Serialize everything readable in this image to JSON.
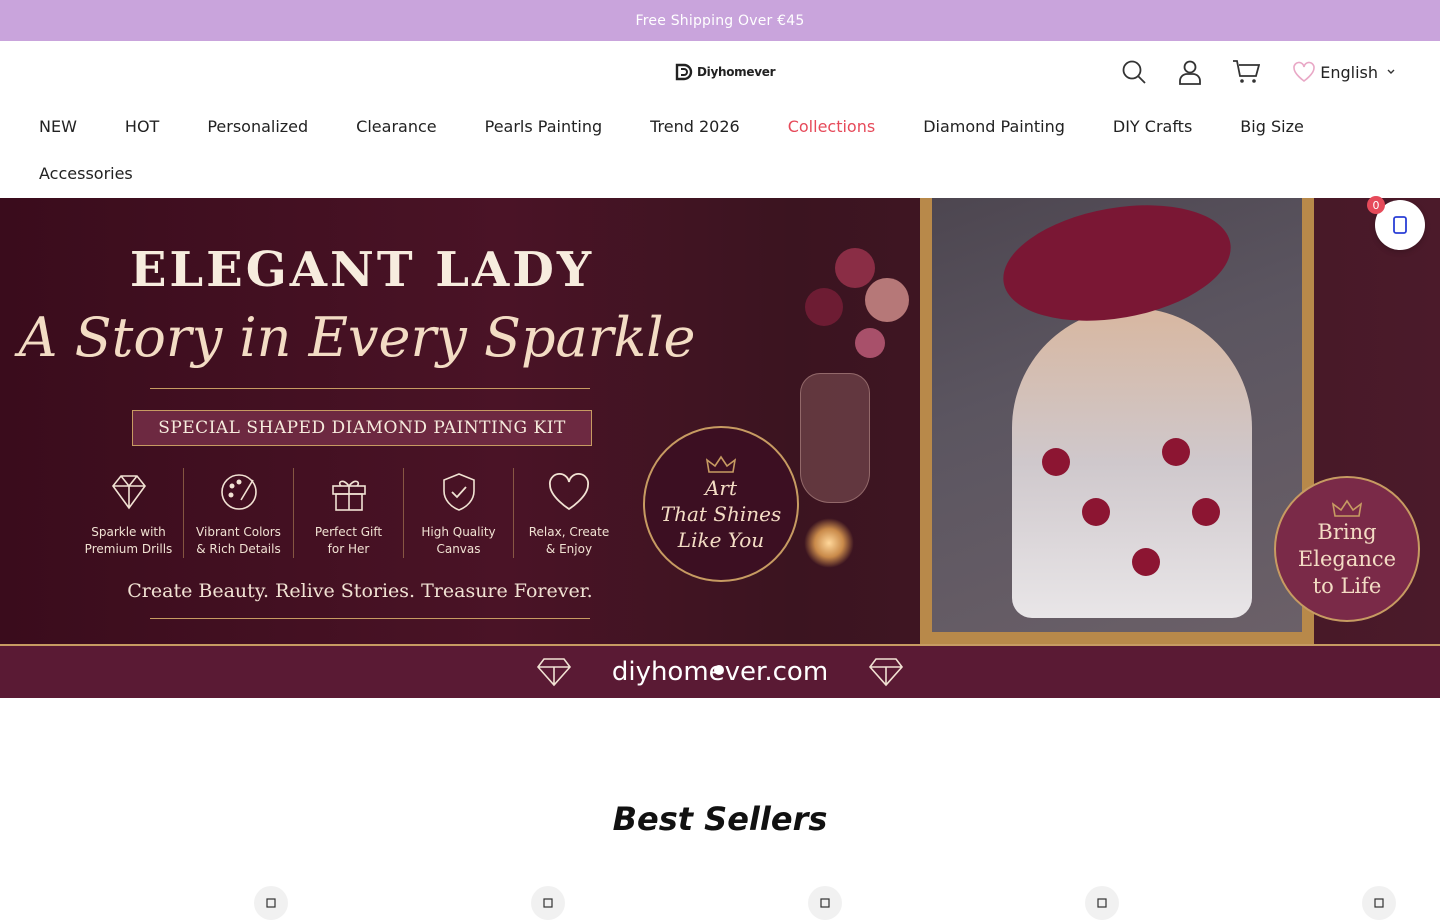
{
  "announcement": {
    "text": "Free Shipping Over €45"
  },
  "header": {
    "logo_text": "Diyhomever",
    "language": "English"
  },
  "nav": {
    "row1": [
      "NEW",
      "HOT",
      "Personalized",
      "Clearance",
      "Pearls Painting",
      "Trend 2026",
      "Collections",
      "Diamond Painting",
      "DIY Crafts",
      "Big Size"
    ],
    "row2": [
      "Accessories"
    ],
    "active": "Collections"
  },
  "hero": {
    "title": "ELEGANT LADY",
    "script": "A Story in Every Sparkle",
    "kit": "SPECIAL SHAPED DIAMOND PAINTING KIT",
    "features": [
      {
        "line1": "Sparkle with",
        "line2": "Premium Drills"
      },
      {
        "line1": "Vibrant Colors",
        "line2": "& Rich Details"
      },
      {
        "line1": "Perfect Gift",
        "line2": "for Her"
      },
      {
        "line1": "High Quality",
        "line2": "Canvas"
      },
      {
        "line1": "Relax, Create",
        "line2": "& Enjoy"
      }
    ],
    "slogan": "Create Beauty. Relive Stories. Treasure Forever.",
    "badge_left": {
      "l1": "Art",
      "l2": "That Shines",
      "l3": "Like You"
    },
    "badge_right": {
      "l1": "Bring",
      "l2": "Elegance",
      "l3": "to Life"
    },
    "domain": "diyhomever.com"
  },
  "cart": {
    "count": "0"
  },
  "best_sellers": {
    "title": "Best Sellers"
  },
  "colors": {
    "announcement_bg": "#c9a4dc",
    "accent": "#e64a5a",
    "hero_bg": "#4a1326",
    "gold": "#c79b62"
  }
}
